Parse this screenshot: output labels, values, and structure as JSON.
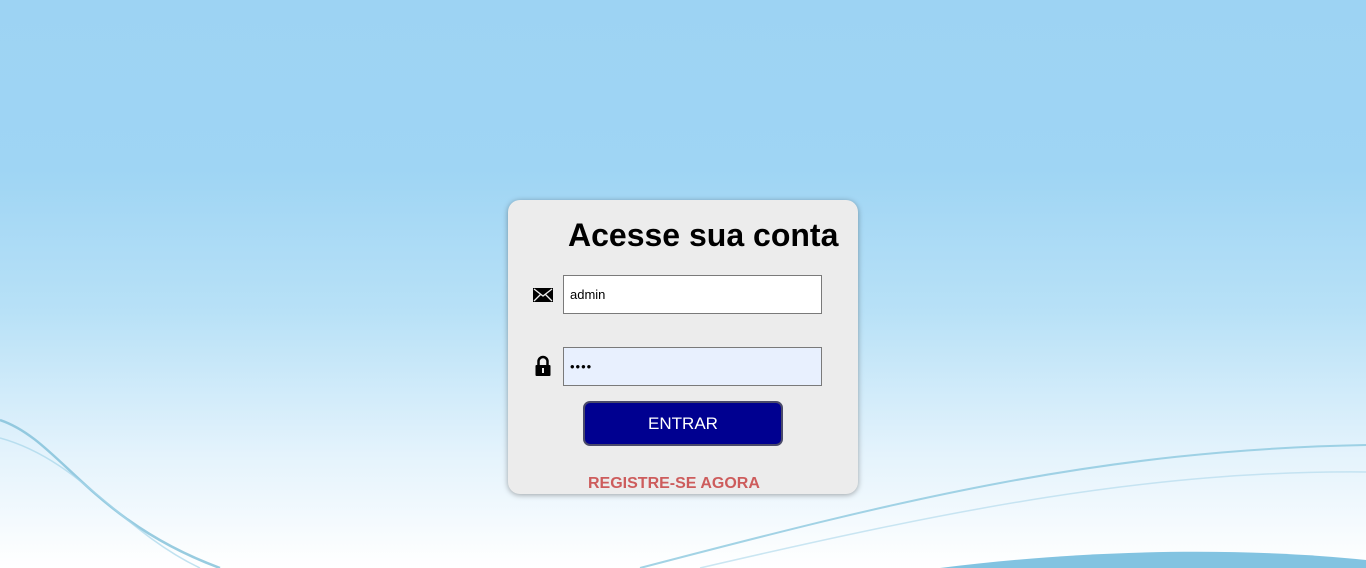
{
  "login": {
    "title": "Acesse sua conta",
    "email_value": "admin",
    "password_value": "••••",
    "enter_label": "ENTRAR",
    "register_label": "REGISTRE-SE AGORA"
  },
  "icons": {
    "email": "envelope-icon",
    "password": "lock-icon"
  },
  "colors": {
    "button_bg": "#000090",
    "register_link": "#cd5c5c",
    "card_bg": "#ececec"
  }
}
